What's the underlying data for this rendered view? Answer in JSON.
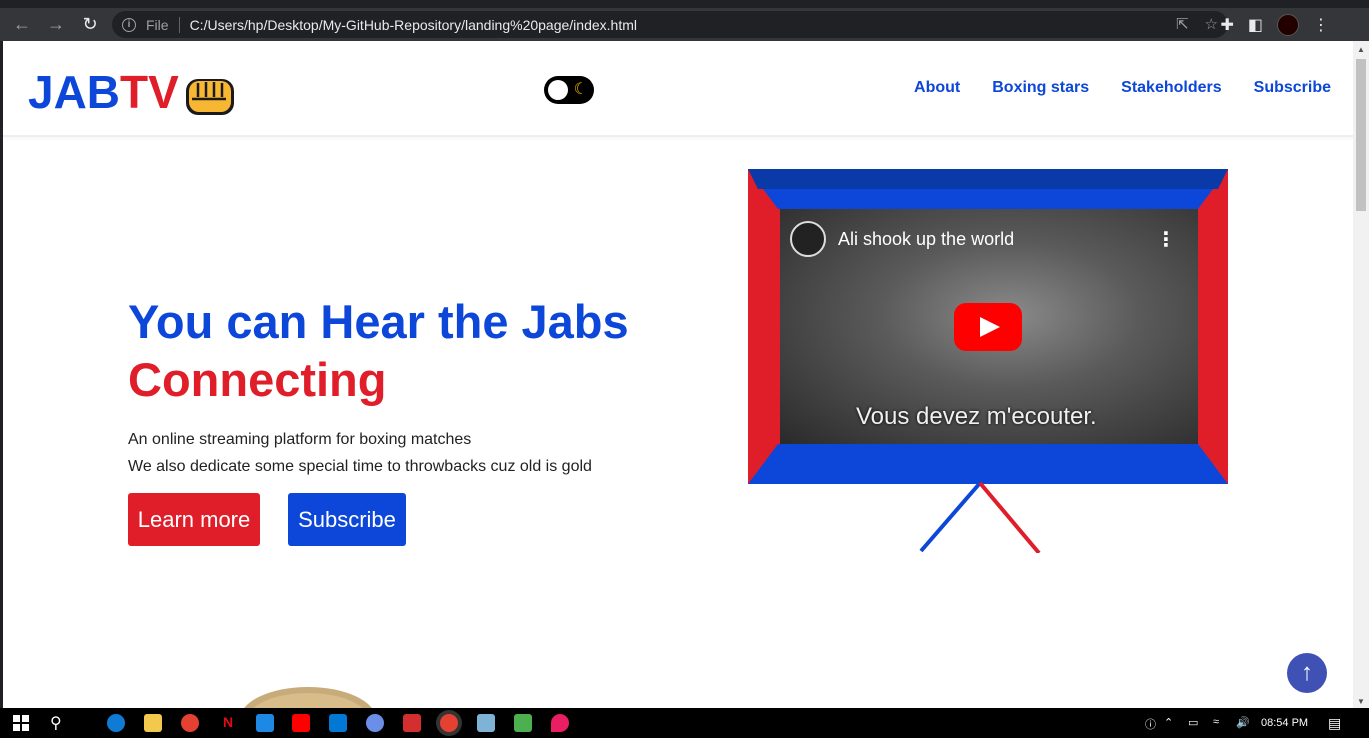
{
  "browser": {
    "file_label": "File",
    "url": "C:/Users/hp/Desktop/My-GitHub-Repository/landing%20page/index.html"
  },
  "header": {
    "logo_part1": "JAB",
    "logo_part2": "TV",
    "nav": [
      "About",
      "Boxing stars",
      "Stakeholders",
      "Subscribe"
    ]
  },
  "hero": {
    "title_line1": "You can Hear the Jabs",
    "title_line2": "Connecting",
    "subtitle_line1": "An online streaming platform for boxing matches",
    "subtitle_line2": "We also dedicate some special time to throwbacks cuz old is gold",
    "learn_more": "Learn more",
    "subscribe": "Subscribe"
  },
  "video": {
    "title": "Ali shook up the world",
    "caption": "Vous devez m'ecouter."
  },
  "taskbar": {
    "time": "08:54 PM"
  },
  "colors": {
    "brand_blue": "#0d47d9",
    "brand_red": "#e01e2a",
    "scroll_top": "#3f51b5"
  }
}
